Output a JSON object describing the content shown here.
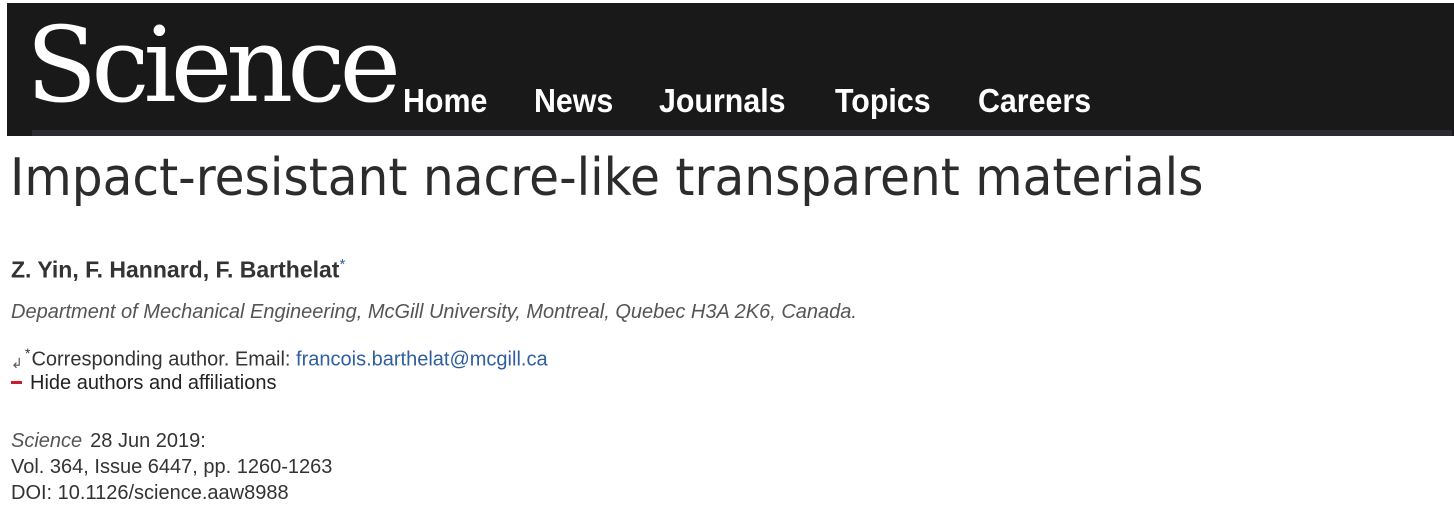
{
  "header": {
    "logo_text": "Science",
    "nav": [
      "Home",
      "News",
      "Journals",
      "Topics",
      "Careers"
    ],
    "background_color": "#191919"
  },
  "article": {
    "title": "Impact-resistant nacre-like transparent materials",
    "authors": "Z. Yin, F. Hannard, F. Barthelat",
    "author_marker": "*",
    "affiliation": "Department of Mechanical Engineering, McGill University, Montreal, Quebec H3A 2K6, Canada.",
    "corresponding": {
      "marker": "*",
      "label": "Corresponding author. Email: ",
      "email": "francois.barthelat@mcgill.ca"
    },
    "hide_authors_label": "Hide authors and affiliations",
    "citation": {
      "journal": "Science",
      "date": "28 Jun 2019:",
      "volume": "Vol. 364, Issue 6447, pp. 1260-1263",
      "doi": "DOI: 10.1126/science.aaw8988"
    }
  },
  "icons": {
    "return": "return-arrow-icon",
    "minus": "minus-icon"
  },
  "colors": {
    "link": "#2f5f9e",
    "minus": "#cc1a2e"
  }
}
